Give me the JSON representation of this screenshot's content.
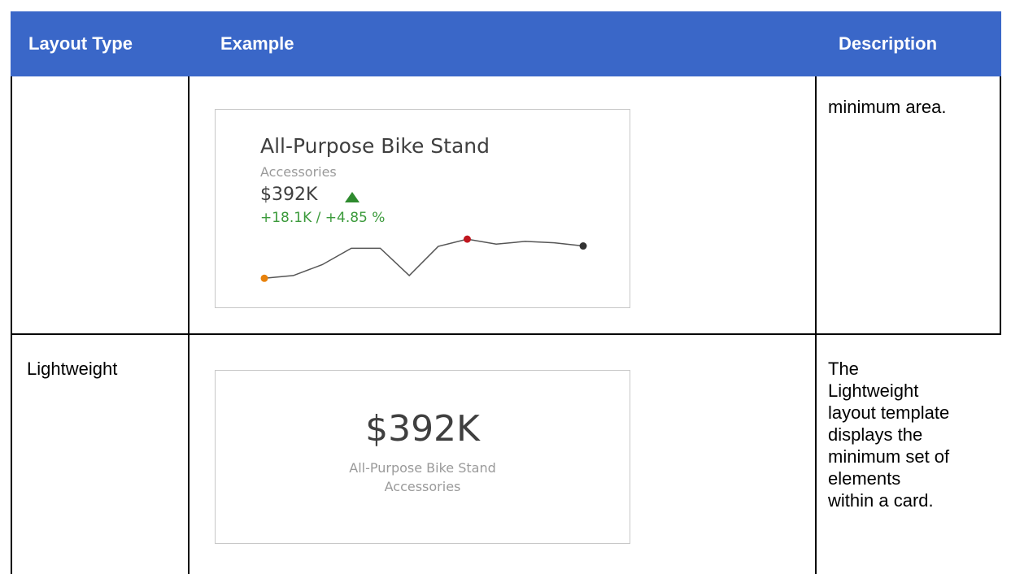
{
  "header": {
    "col_type": "Layout Type",
    "col_example": "Example",
    "col_description": "Description"
  },
  "rows": [
    {
      "type": "",
      "description_lines": [
        "minimum area."
      ],
      "card": {
        "title": "All-Purpose Bike Stand",
        "subtitle": "Accessories",
        "value": "$392K",
        "delta": "+18.1K / +4.85 %",
        "indicator_icon": "triangle-up-icon",
        "sparkline": [
          0.12,
          0.18,
          0.42,
          0.78,
          0.78,
          0.18,
          0.82,
          0.98,
          0.87,
          0.93,
          0.9,
          0.83
        ],
        "sparkline_start_index": 0,
        "sparkline_max_index": 7,
        "sparkline_end_index": 11
      }
    },
    {
      "type": "Lightweight",
      "description_lines": [
        "The",
        "Lightweight",
        "layout template",
        "displays the",
        "minimum set of",
        "elements",
        "within a card."
      ],
      "card": {
        "value": "$392K",
        "title": "All-Purpose Bike Stand",
        "subtitle": "Accessories"
      }
    }
  ],
  "colors": {
    "header_bg": "#3a67c8",
    "positive": "#3b9a3b",
    "spark_line": "#555555",
    "spark_start": "#e8820c",
    "spark_max": "#c0161e",
    "spark_end": "#333333"
  }
}
